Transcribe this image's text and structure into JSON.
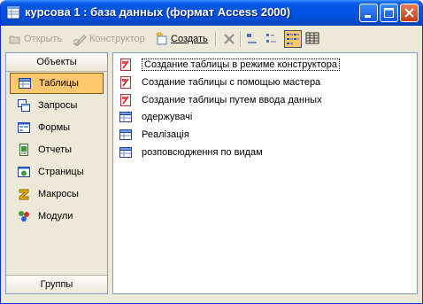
{
  "window": {
    "title": "курсова 1 : база данных (формат Access 2000)"
  },
  "toolbar": {
    "open_label": "Открыть",
    "designer_label": "Конструктор",
    "create_label": "Создать"
  },
  "objects_pane": {
    "header": "Объекты",
    "footer": "Группы",
    "items": [
      {
        "label": "Таблицы",
        "icon": "table-icon",
        "selected": true
      },
      {
        "label": "Запросы",
        "icon": "query-icon"
      },
      {
        "label": "Формы",
        "icon": "form-icon"
      },
      {
        "label": "Отчеты",
        "icon": "report-icon"
      },
      {
        "label": "Страницы",
        "icon": "page-icon"
      },
      {
        "label": "Макросы",
        "icon": "macro-icon"
      },
      {
        "label": "Модули",
        "icon": "module-icon"
      }
    ]
  },
  "list": {
    "items": [
      {
        "label": "Создание таблицы в режиме конструктора",
        "icon": "create-shortcut-icon"
      },
      {
        "label": "Создание таблицы с помощью мастера",
        "icon": "create-shortcut-icon"
      },
      {
        "label": "Создание таблицы путем ввода данных",
        "icon": "create-shortcut-icon"
      },
      {
        "label": "одержувачі",
        "icon": "table-icon"
      },
      {
        "label": "Реалізація",
        "icon": "table-icon"
      },
      {
        "label": "розповсюдження по видам",
        "icon": "table-icon"
      }
    ]
  },
  "colors": {
    "titlebar": "#0054e3",
    "selection": "#ffc76e",
    "chrome": "#ece9d8"
  }
}
